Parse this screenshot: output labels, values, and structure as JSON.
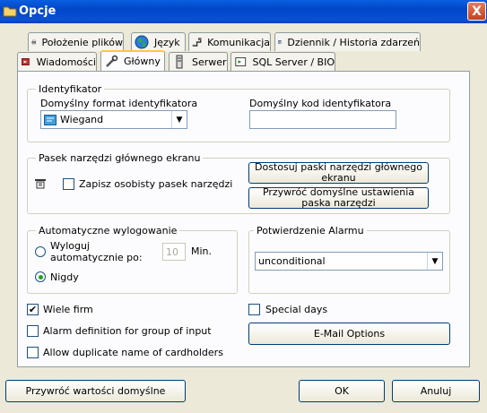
{
  "window": {
    "title": "Opcje",
    "close": "X"
  },
  "tabs_row1": [
    {
      "label": "Położenie plików",
      "icon": "printer-icon"
    },
    {
      "label": "Język",
      "icon": "globe-icon"
    },
    {
      "label": "Komunikacja",
      "icon": "network-icon"
    },
    {
      "label": "Dziennik / Historia zdarzeń",
      "icon": "journal-icon"
    }
  ],
  "tabs_row2": [
    {
      "label": "Wiadomości",
      "icon": "message-icon"
    },
    {
      "label": "Główny",
      "icon": "tools-icon",
      "active": true
    },
    {
      "label": "Serwer",
      "icon": "server-icon"
    },
    {
      "label": "SQL Server / BIO",
      "icon": "sql-icon"
    }
  ],
  "identifier": {
    "legend": "Identyfikator",
    "format_label": "Domyślny format identyfikatora",
    "format_value": "Wiegand",
    "code_label": "Domyślny kod identyfikatora",
    "code_value": ""
  },
  "toolbar": {
    "legend": "Pasek narzędzi głównego ekranu",
    "save_checkbox": "Zapisz osobisty pasek narzędzi",
    "customize_button": "Dostosuj paski narzędzi głównego ekranu",
    "restore_button": "Przywróć domyślne ustawienia paska narzędzi"
  },
  "logout": {
    "legend": "Automatyczne wylogowanie",
    "auto_label": "Wyloguj automatycznie po:",
    "minutes_value": "10",
    "minutes_unit": "Min.",
    "never_label": "Nigdy",
    "selected": "never"
  },
  "alarm": {
    "legend": "Potwierdzenie Alarmu",
    "value": "unconditional"
  },
  "options": {
    "multi_firm": "Wiele firm",
    "multi_firm_checked": true,
    "alarm_group": "Alarm definition for group of input",
    "alarm_group_checked": false,
    "duplicate_names": "Allow duplicate name of cardholders",
    "duplicate_names_checked": false,
    "special_days": "Special days",
    "special_days_checked": false,
    "email_button": "E-Mail Options"
  },
  "footer": {
    "restore_defaults": "Przywróć wartości domyślne",
    "ok": "OK",
    "cancel": "Anuluj"
  }
}
